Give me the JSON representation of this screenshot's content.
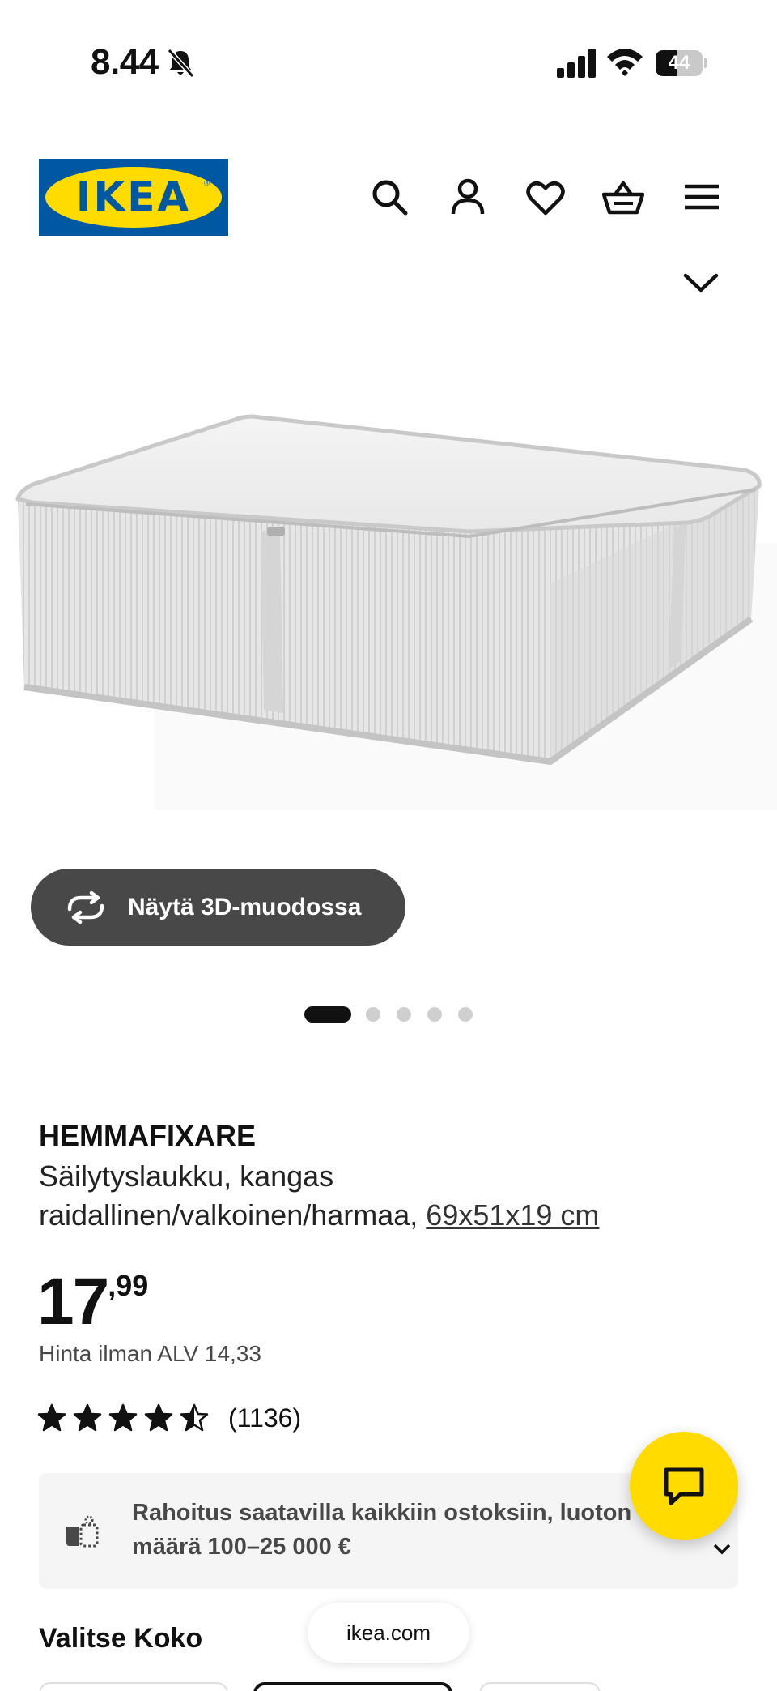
{
  "status_bar": {
    "time": "8.44",
    "battery": "44",
    "battery_level": 0.44,
    "icons": [
      "bell-slash-icon",
      "signal-icon",
      "wifi-icon",
      "battery-icon"
    ]
  },
  "header": {
    "logo_text": "IKEA",
    "logo_reg": "®",
    "logo_colors": {
      "blue": "#0058a3",
      "yellow": "#ffdb00"
    },
    "icons": [
      "search-icon",
      "account-icon",
      "heart-icon",
      "cart-icon",
      "menu-icon",
      "chevron-down-icon"
    ]
  },
  "gallery": {
    "view_3d_label": "Näytä 3D-muodossa",
    "dot_count": 5,
    "active_dot": 1
  },
  "product": {
    "name": "HEMMAFIXARE",
    "description_line1": "Säilytyslaukku, kangas",
    "description_line2": "raidallinen/valkoinen/harmaa, ",
    "size_link": "69x51x19 cm",
    "price_int": "17",
    "price_dec": ",99",
    "price_vat": "Hinta ilman ALV 14,33",
    "rating_value": 4.5,
    "rating_max": 5,
    "rating_count": "(1136)"
  },
  "finance": {
    "text": "Rahoitus saatavilla kaikkiin ostoksiin, luoton määrä 100–25 000 €"
  },
  "chat": {
    "accent": "#ffdb00"
  },
  "size_section": {
    "title": "Valitse Koko"
  },
  "browser": {
    "url": "ikea.com"
  }
}
